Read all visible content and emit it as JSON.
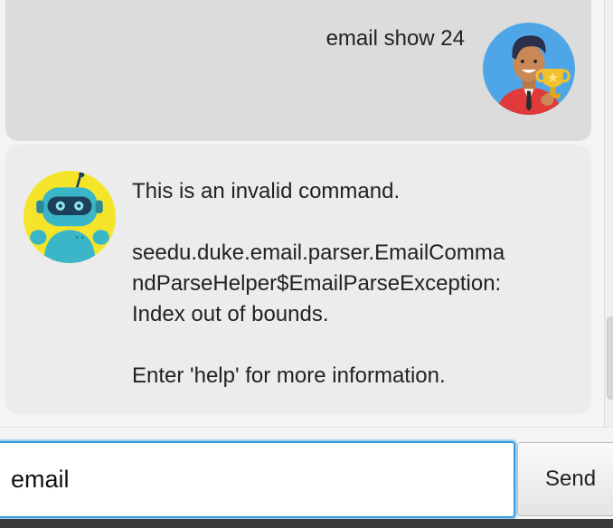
{
  "conversation": {
    "user_message": {
      "text": "email show 24",
      "avatar_icon": "user-avatar-icon"
    },
    "bot_message": {
      "lines": [
        "This is an invalid command.",
        "",
        "seedu.duke.email.parser.EmailComma",
        "ndParseHelper$EmailParseException:",
        "Index out of bounds.",
        "",
        "Enter 'help' for more information."
      ],
      "avatar_icon": "robot-avatar-icon"
    }
  },
  "input": {
    "value": "email",
    "placeholder": ""
  },
  "send_button": {
    "label": "Send"
  },
  "colors": {
    "user_bubble": "#dcdcdc",
    "bot_bubble": "#ececec",
    "input_focus": "#3a9bdc",
    "robot_background": "#f5e52a",
    "user_avatar_background": "#4fa6e6"
  }
}
